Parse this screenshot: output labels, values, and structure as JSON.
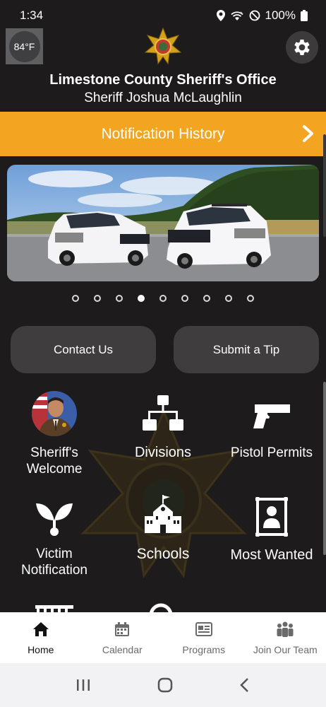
{
  "status": {
    "time": "1:34",
    "battery": "100%"
  },
  "weather": {
    "temp": "84°F"
  },
  "header": {
    "title": "Limestone County Sheriff's Office",
    "subtitle": "Sheriff Joshua McLaughlin"
  },
  "notification": {
    "label": "Notification History"
  },
  "carousel": {
    "slide_count": 9,
    "active_index": 3
  },
  "actions": {
    "contact": "Contact Us",
    "tip": "Submit a Tip"
  },
  "tiles": [
    {
      "label": "Sheriff's Welcome",
      "icon": "sheriff-avatar"
    },
    {
      "label": "Divisions",
      "icon": "org-chart-icon"
    },
    {
      "label": "Pistol Permits",
      "icon": "pistol-icon"
    },
    {
      "label": "Victim Notification",
      "icon": "sprout-icon"
    },
    {
      "label": "Schools",
      "icon": "school-icon"
    },
    {
      "label": "Most Wanted",
      "icon": "wanted-poster-icon"
    }
  ],
  "tile_labels": {
    "sheriff_1": "Sheriff's",
    "sheriff_2": "Welcome",
    "divisions": "Divisions",
    "pistol": "Pistol Permits",
    "victim_1": "Victim",
    "victim_2": "Notification",
    "schools": "Schools",
    "wanted": "Most Wanted"
  },
  "bottom_nav": {
    "home": "Home",
    "calendar": "Calendar",
    "programs": "Programs",
    "join": "Join Our Team"
  },
  "colors": {
    "background": "#1d1b1c",
    "accent": "#f3a521",
    "button": "#3f3d3e"
  }
}
